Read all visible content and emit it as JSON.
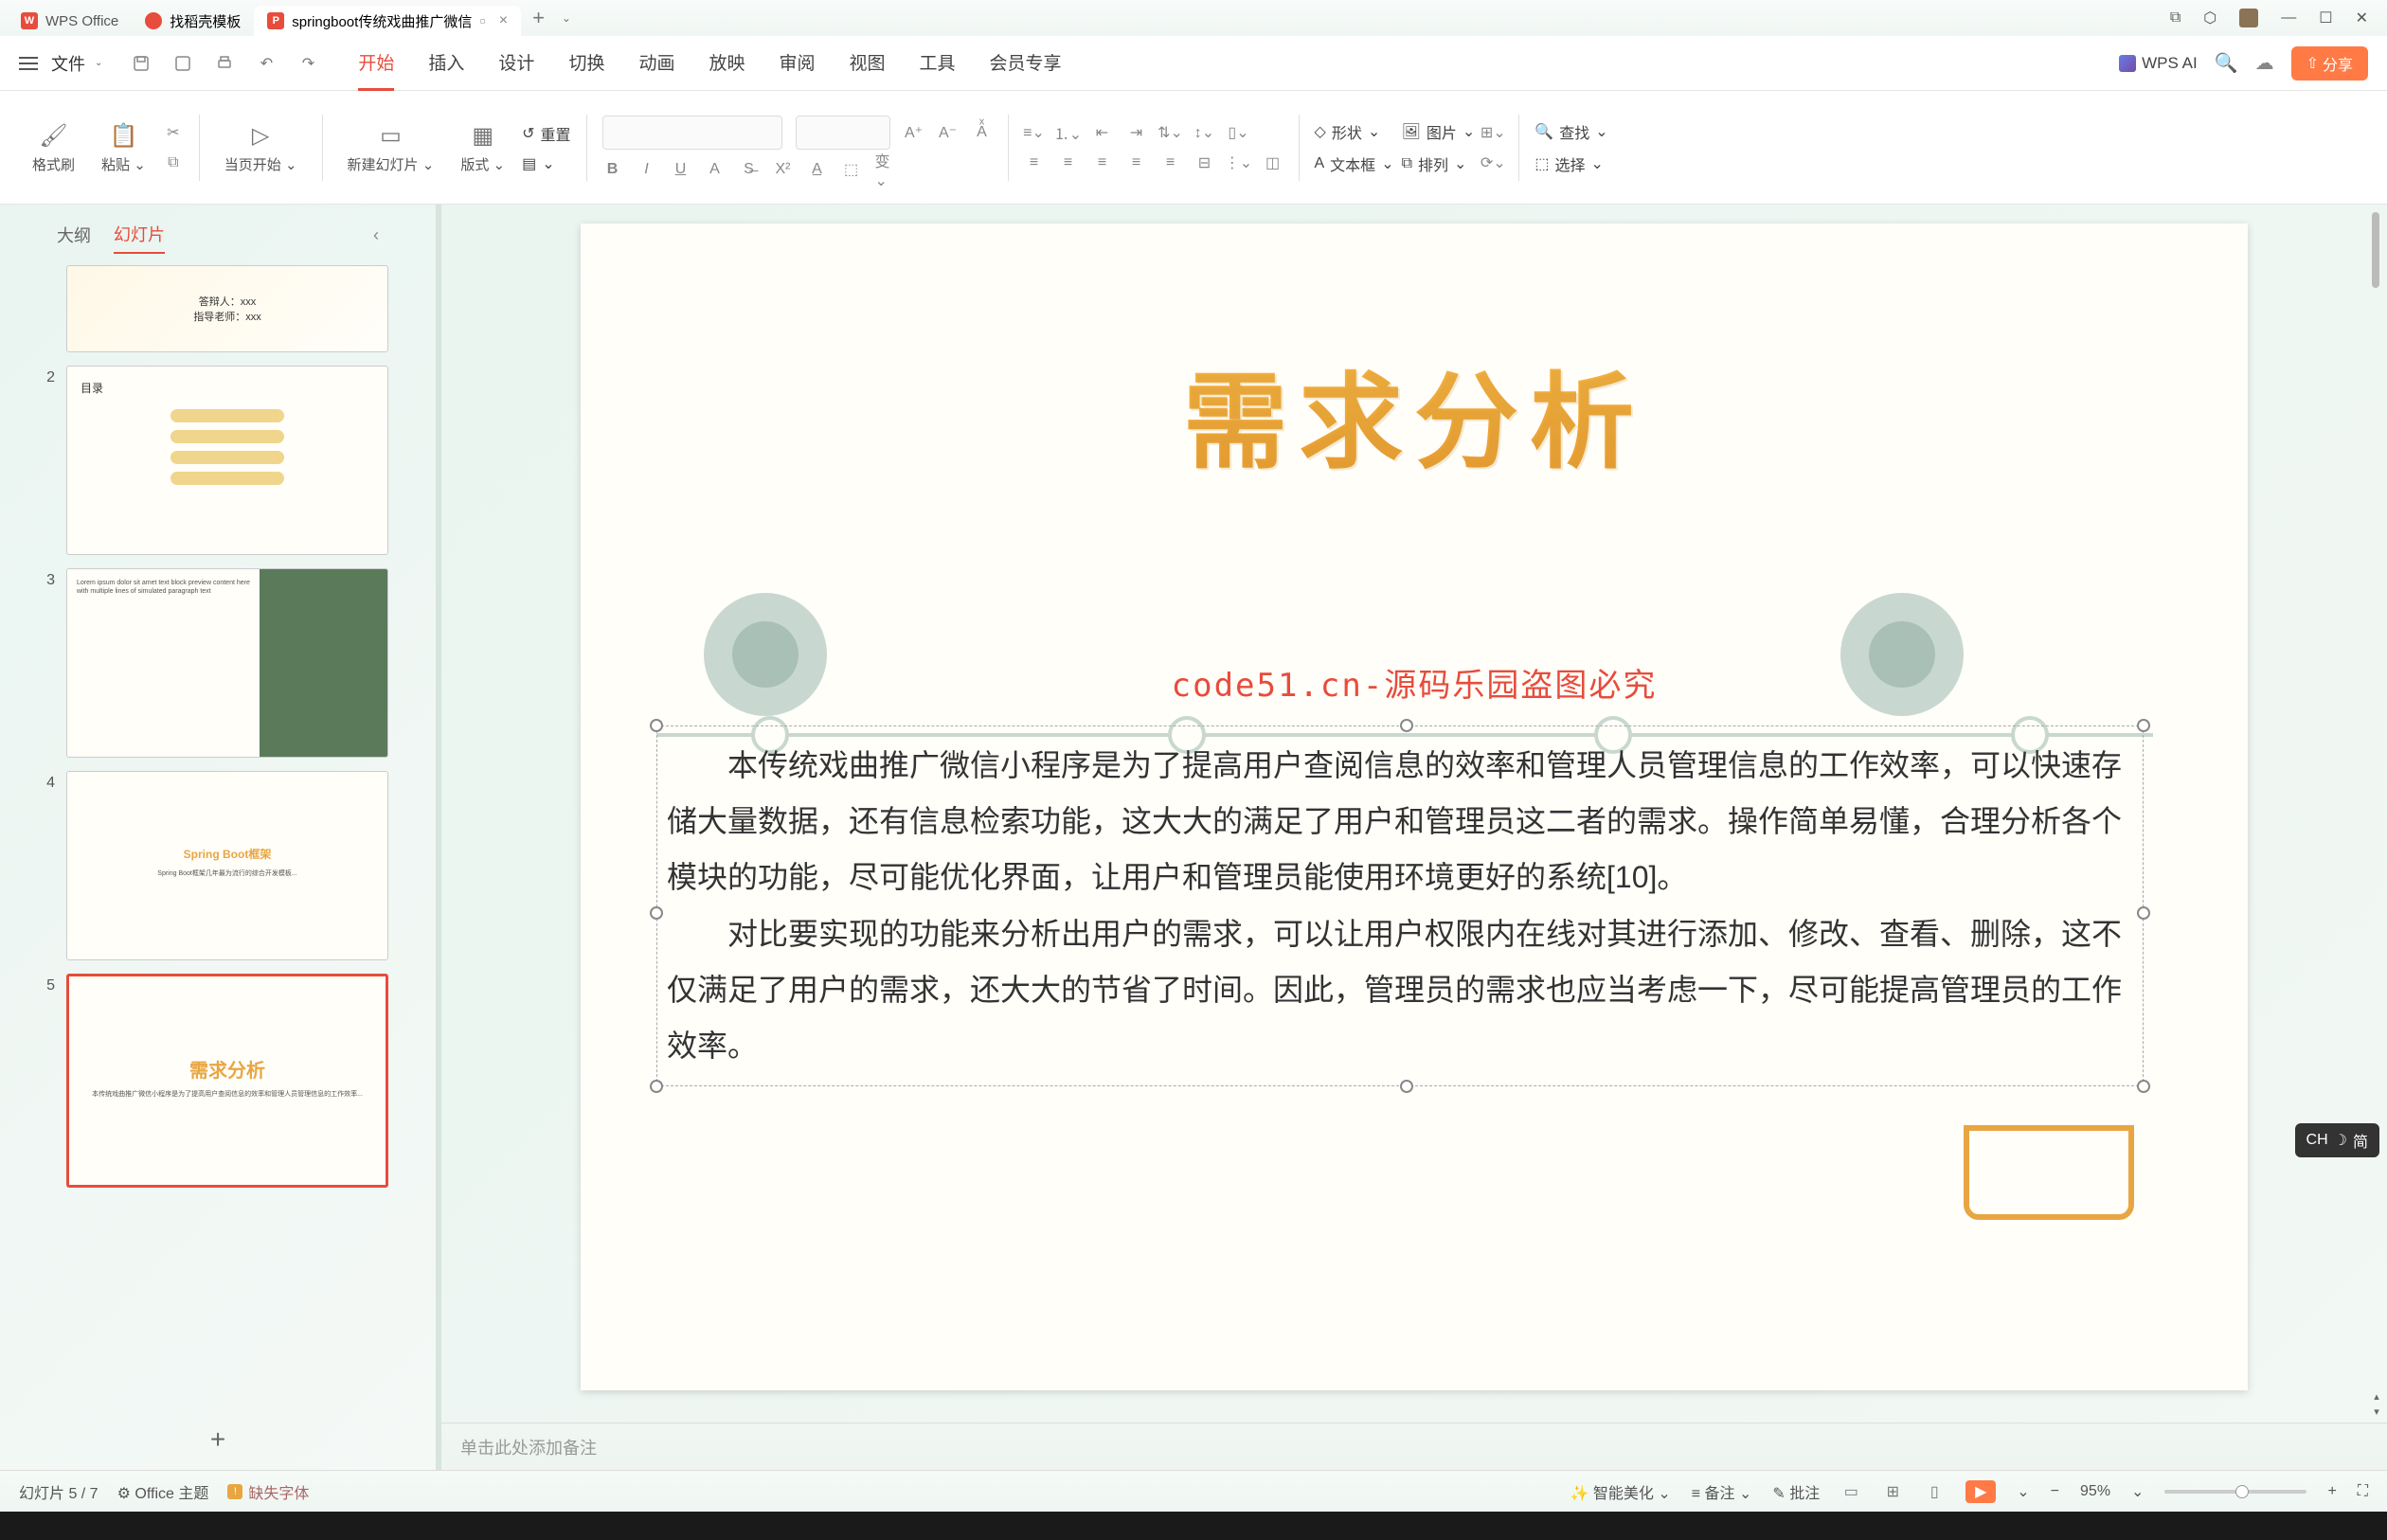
{
  "tabs": {
    "app": "WPS Office",
    "template": "找稻壳模板",
    "doc": "springboot传统戏曲推广微信",
    "doc_icon": "P"
  },
  "menu": {
    "file": "文件",
    "items": [
      "开始",
      "插入",
      "设计",
      "切换",
      "动画",
      "放映",
      "审阅",
      "视图",
      "工具",
      "会员专享"
    ],
    "wps_ai": "WPS AI",
    "share": "分享"
  },
  "ribbon": {
    "format_painter": "格式刷",
    "paste": "粘贴",
    "current_page": "当页开始",
    "new_slide": "新建幻灯片",
    "layout": "版式",
    "reset": "重置",
    "shape": "形状",
    "image": "图片",
    "textbox": "文本框",
    "arrange": "排列",
    "find": "查找",
    "select": "选择"
  },
  "sidebar": {
    "outline": "大纲",
    "slides": "幻灯片",
    "thumbs": [
      {
        "num": "",
        "lines": [
          "答辩人：xxx",
          "指导老师：xxx"
        ]
      },
      {
        "num": "2",
        "title": "目录"
      },
      {
        "num": "3",
        "title": ""
      },
      {
        "num": "4",
        "title": "Spring Boot框架"
      },
      {
        "num": "5",
        "title": "需求分析"
      }
    ]
  },
  "slide": {
    "title": "需求分析",
    "watermark": "code51.cn-源码乐园盗图必究",
    "para1": "本传统戏曲推广微信小程序是为了提高用户查阅信息的效率和管理人员管理信息的工作效率，可以快速存储大量数据，还有信息检索功能，这大大的满足了用户和管理员这二者的需求。操作简单易懂，合理分析各个模块的功能，尽可能优化界面，让用户和管理员能使用环境更好的系统[10]。",
    "para2": "对比要实现的功能来分析出用户的需求，可以让用户权限内在线对其进行添加、修改、查看、删除，这不仅满足了用户的需求，还大大的节省了时间。因此，管理员的需求也应当考虑一下，尽可能提高管理员的工作效率。"
  },
  "notes": {
    "placeholder": "单击此处添加备注"
  },
  "status": {
    "slide_count": "幻灯片 5 / 7",
    "theme": "Office 主题",
    "missing_font": "缺失字体",
    "smart_beautify": "智能美化",
    "notes_btn": "备注",
    "comments": "批注",
    "zoom": "95%"
  },
  "ime": {
    "lang": "CH",
    "mode": "简"
  }
}
